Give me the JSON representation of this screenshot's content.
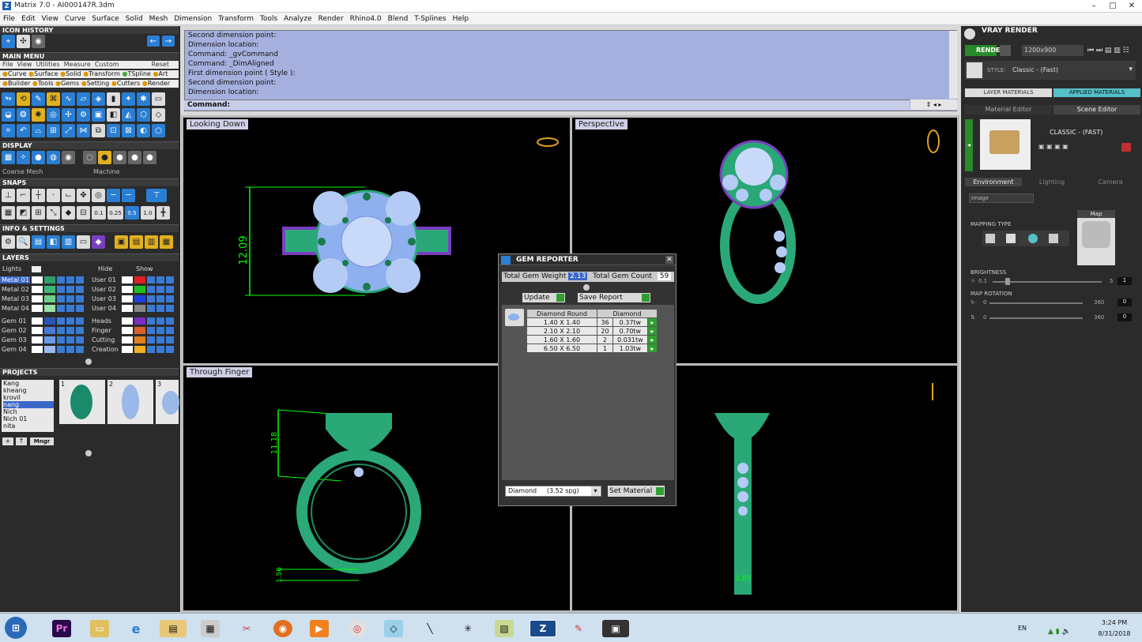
{
  "window": {
    "title": "Matrix 7.0 - AI000147R.3dm"
  },
  "menu": [
    "File",
    "Edit",
    "View",
    "Curve",
    "Surface",
    "Solid",
    "Mesh",
    "Dimension",
    "Transform",
    "Tools",
    "Analyze",
    "Render",
    "Rhino4.0",
    "Blend",
    "T-Splines",
    "Help"
  ],
  "left": {
    "icon_history": "ICON HISTORY",
    "main_menu": "MAIN MENU",
    "submenu": [
      "File",
      "View",
      "Utilities",
      "Measure",
      "Custom"
    ],
    "reset": "Reset",
    "cat_row1": [
      "Curve",
      "Surface",
      "Solid",
      "Transform",
      "TSpline",
      "Art"
    ],
    "cat_row2": [
      "Builder",
      "Tools",
      "Gems",
      "Setting",
      "Cutters",
      "Render"
    ],
    "display": "DISPLAY",
    "display_opts": [
      "Coarse Mesh",
      "Machine"
    ],
    "snaps": "SNAPS",
    "snap_vals": [
      "0.1",
      "0.25",
      "0.5",
      "1.0"
    ],
    "info": "INFO & SETTINGS",
    "layers": "LAYERS",
    "lights": "Lights",
    "hide": "Hide",
    "show": "Show",
    "layers_left": [
      "Metal 01",
      "Metal 02",
      "Metal 03",
      "Metal 04",
      "Gem 01",
      "Gem 02",
      "Gem 03",
      "Gem 04"
    ],
    "layers_right": [
      "User 01",
      "User 02",
      "User 03",
      "User 04",
      "Heads",
      "Finger",
      "Cutting",
      "Creation"
    ],
    "projects": "PROJECTS",
    "project_list": [
      "Kang",
      "kheang",
      "krovil",
      "nang",
      "Nich",
      "Nich 01",
      "nita"
    ],
    "mngr": "Mngr",
    "thumb_nums": [
      "1",
      "2",
      "3"
    ]
  },
  "command": {
    "lines": [
      "Second dimension point:",
      "Dimension location:",
      "Command: _gvCommand",
      "Command: _DimAligned",
      "First dimension point ( Style ):",
      "Second dimension point:",
      "Dimension location:"
    ],
    "prompt": "Command:"
  },
  "viewports": {
    "top_left": "Looking Down",
    "top_right": "Perspective",
    "bottom_left": "Through Finger",
    "dim_top": "12.09",
    "dim_side": "11.18",
    "dim_band": "1.56",
    "dim_front": "2.89"
  },
  "gem_reporter": {
    "title": "GEM REPORTER",
    "weight_label": "Total Gem Weight",
    "weight": "2.13",
    "count_label": "Total Gem Count",
    "count": "59",
    "update": "Update",
    "save_report": "Save Report",
    "col1": "Diamond Round",
    "col2": "Diamond",
    "rows": [
      {
        "size": "1.40 X 1.40",
        "qty": "36",
        "tw": "0.37tw"
      },
      {
        "size": "2.10 X 2.10",
        "qty": "20",
        "tw": "0.70tw"
      },
      {
        "size": "1.60 X 1.60",
        "qty": "2",
        "tw": "0.031tw"
      },
      {
        "size": "6.50 X 6.50",
        "qty": "1",
        "tw": "1.03tw"
      }
    ],
    "material": "Diamond     (3.52 spg)",
    "set_material": "Set Material"
  },
  "vray": {
    "title": "VRAY RENDER",
    "render": "RENDER",
    "resolution": "1200x900",
    "style_label": "STYLE:",
    "style": "Classic - (Fast)",
    "layer_materials": "LAYER MATERIALS",
    "applied_materials": "APPLIED MATERIALS",
    "material_editor": "Material Editor",
    "scene_editor": "Scene Editor",
    "preset": "CLASSIC - (FAST)",
    "tabs": [
      "Environment",
      "Lighting",
      "Camera"
    ],
    "image": "Image",
    "mapping_type": "MAPPING TYPE",
    "map": "Map",
    "brightness": "BRIGHTNESS",
    "bright_min": "0.1",
    "bright_max": "5",
    "bright_val": "1",
    "map_rotation": "MAP ROTATION",
    "rot_min": "0",
    "rot_max": "360",
    "rot_val": "0"
  },
  "taskbar": {
    "lang": "EN",
    "time": "3:24 PM",
    "date": "8/31/2018"
  }
}
